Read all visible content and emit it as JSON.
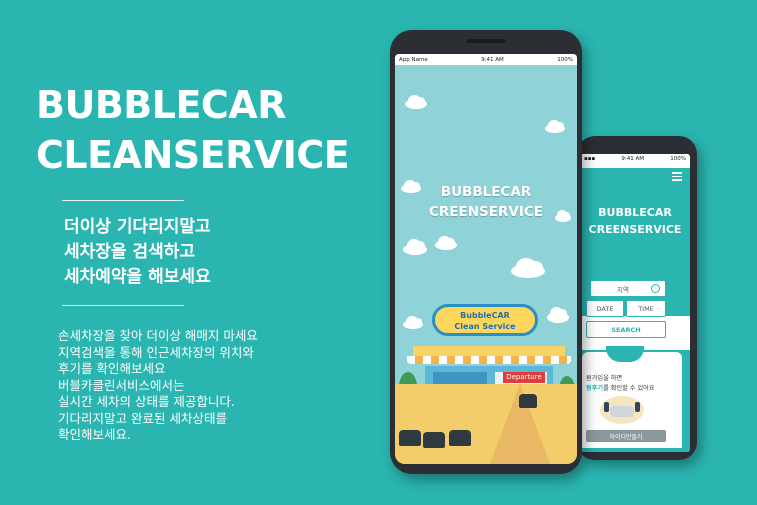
{
  "hero": {
    "title_line1": "BUBBLECAR",
    "title_line2": "CLEANSERVICE"
  },
  "tagline": [
    "더이상 기다리지말고",
    "세차장을 검색하고",
    "세차예약을 해보세요"
  ],
  "description": [
    "손세차장을 찾아 더이상 해매지 마세요",
    "지역검색을 통해 인근세차장의 위치와",
    "후기를 확인해보세요",
    "버블카클린서비스에서는",
    "실시간 세차의 상태를 제공합니다.",
    "기다리지말고 완료된 세차상태를",
    "확인해보세요."
  ],
  "main_phone": {
    "status": {
      "carrier": "App Name",
      "time": "9:41 AM",
      "battery": "100%"
    },
    "title_line1": "BUBBLECAR",
    "title_line2": "CREENSERVICE",
    "sign_line1": "BubbleCAR",
    "sign_line2": "Clean Service",
    "departure_label": "Departure"
  },
  "back_phone": {
    "status": {
      "time": "9:41 AM",
      "battery": "100%"
    },
    "title_line1": "BUBBLECAR",
    "title_line2": "CREENSERVICE",
    "search_placeholder": "지역",
    "date_label": "DATE",
    "time_label": "TIME",
    "search_button": "SEARCH",
    "card_line1": "원가입을 하면",
    "card_line2_highlight": "원후기",
    "card_line2_rest": "를 확인할 수 있어요",
    "signup_button": "아이디만들기"
  },
  "colors": {
    "background": "#2ab5b0",
    "sky": "#8fd3d8",
    "ground": "#f2cd6a",
    "departure": "#e23b3b"
  }
}
